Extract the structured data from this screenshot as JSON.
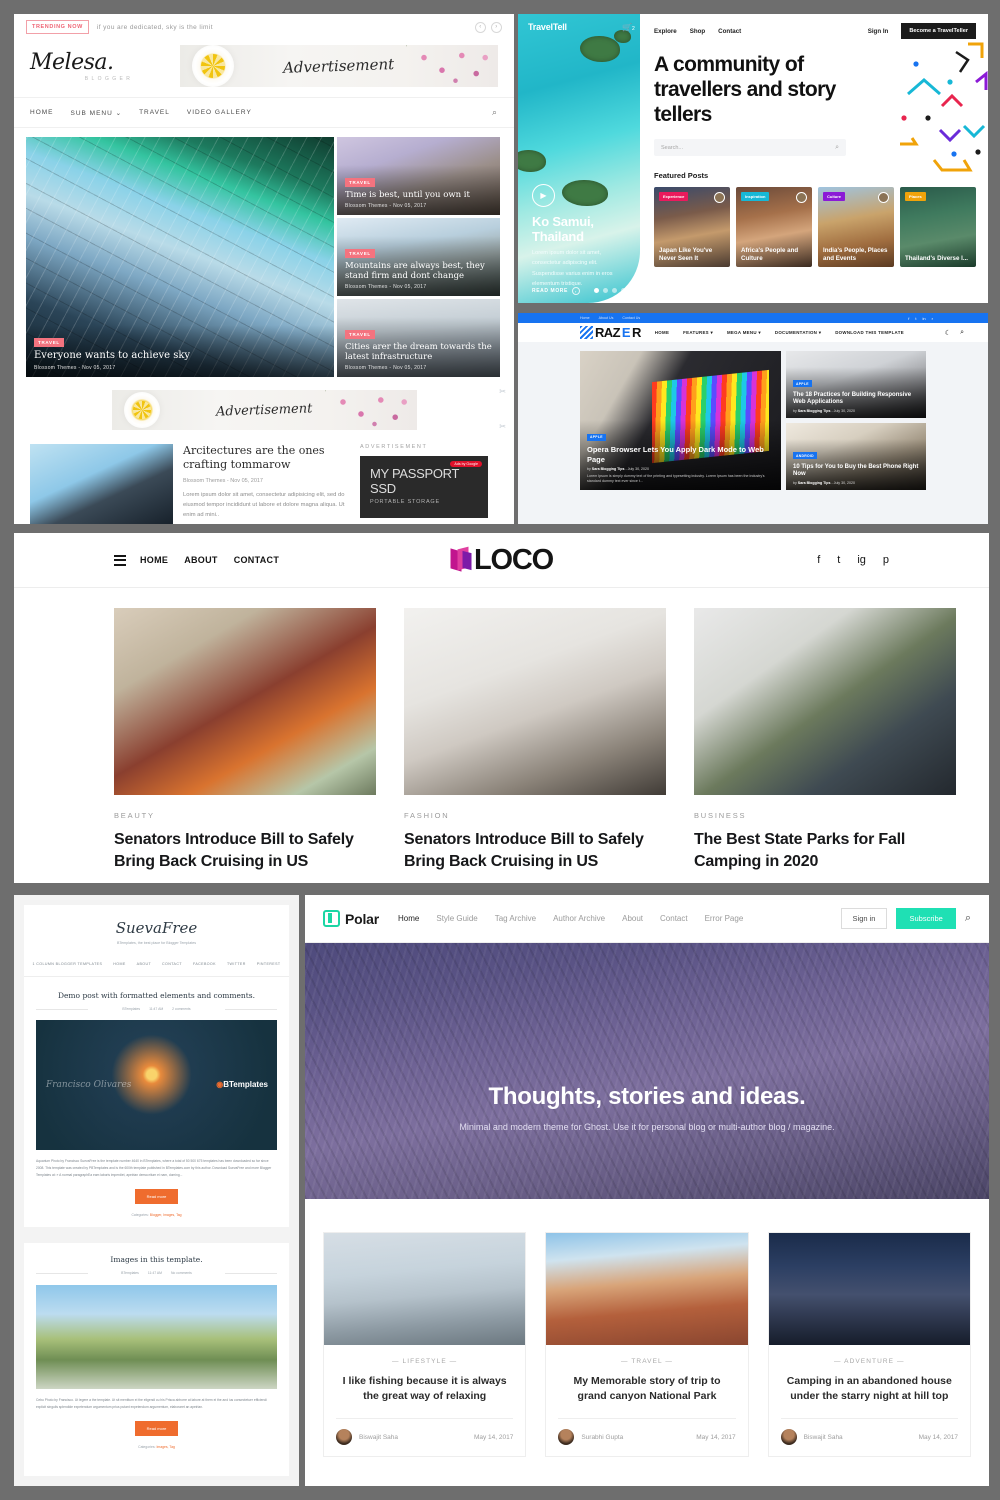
{
  "melesa": {
    "trending_badge": "TRENDING NOW",
    "trending_text": "if you are dedicated, sky is the limit",
    "prev_icon": "‹",
    "next_icon": "›",
    "logo": "Melesa.",
    "logo_sub": "BLOGGER",
    "ad_text": "Advertisement",
    "nav": [
      "HOME",
      "SUB MENU",
      "TRAVEL",
      "VIDEO GALLERY"
    ],
    "submenu_caret": "⌄",
    "search_icon": "⌕",
    "hero": {
      "tag": "TRAVEL",
      "title": "Everyone wants to achieve sky",
      "meta": "Blossom Themes - Nov 05, 2017"
    },
    "cards": [
      {
        "tag": "TRAVEL",
        "title": "Time is best, until you own it",
        "meta": "Blossom Themes - Nov 05, 2017"
      },
      {
        "tag": "TRAVEL",
        "title": "Mountains are always best, they stand firm and dont change",
        "meta": "Blossom Themes - Nov 05, 2017"
      },
      {
        "tag": "TRAVEL",
        "title": "Cities arer the dream towards the latest infrastructure",
        "meta": "Blossom Themes - Nov 05, 2017"
      }
    ],
    "ad2_text": "Advertisement",
    "post": {
      "title": "Arcitectures are the ones crafting tommarow",
      "meta": "Blossom Themes - Nov 05, 2017",
      "excerpt": "Lorem ipsum dolor sit amet, consectetur adipisicing elit, sed do eiusmod tempor incididunt ut labore et dolore magna aliqua. Ut enim ad mini.."
    },
    "ad_label": "ADVERTISEMENT",
    "ad_product": "MY PASSPORT",
    "ad_product_suffix": "SSD",
    "ad_product_sub": "PORTABLE STORAGE",
    "ad_pill": "Ads by Google"
  },
  "traveltell": {
    "logo": "TravelTell",
    "cart_icon": "🛒",
    "cart_count": "2",
    "nav": [
      "Explore",
      "Shop",
      "Contact"
    ],
    "signin": "Sign In",
    "cta": "Become a TravelTeller",
    "headline": "A community of travellers and story tellers",
    "search_placeholder": "Search...",
    "search_icon": "⌕",
    "featured_label": "Featured Posts",
    "slide": {
      "title": "Ko Samui, Thailand",
      "text": "Lorem ipsum dolor sit amet, consectetur adipiscing elit. Suspendisse varius enim in eros elementum tristique.",
      "read_more": "READ MORE"
    },
    "featured": [
      {
        "cat": "Experience",
        "cat_color": "#ea1a5c",
        "title": "Japan Like You've Never Seen It"
      },
      {
        "cat": "Inspiration",
        "cat_color": "#17b8d6",
        "title": "Africa's People and Culture"
      },
      {
        "cat": "Culture",
        "cat_color": "#8b1ad6",
        "title": "India's People, Places and Events"
      },
      {
        "cat": "Places",
        "cat_color": "#f0a30a",
        "title": "Thailand's Diverse I..."
      }
    ]
  },
  "razer": {
    "topnav": [
      "Home",
      "About Us",
      "Contact Us"
    ],
    "social": [
      "f",
      "t",
      "in",
      "r"
    ],
    "logo": "RAZ",
    "logo_accent": "E",
    "logo_end": "R",
    "nav": [
      "HOME",
      "FEATURES",
      "MEGA MENU",
      "DOCUMENTATION",
      "DOWNLOAD THIS TEMPLATE"
    ],
    "caret": "▾",
    "moon_icon": "☾",
    "search_icon": "⌕",
    "main_post": {
      "cat": "APPLE",
      "title": "Opera Browser Lets You Apply Dark Mode to Web Page",
      "by": "by ",
      "author": "Sara Blogging Tips",
      "date": " - July 30, 2020",
      "excerpt": "Lorem Ipsum is simply dummy text of the printing and typesetting industry. Lorem Ipsum has been the industry's standard dummy text ever since t..."
    },
    "side_posts": [
      {
        "cat": "APPLE",
        "title": "The 18 Practices for Building Responsive Web Applications",
        "by": "by ",
        "author": "Sara Blogging Tips",
        "date": " - July 30, 2020"
      },
      {
        "cat": "ANDROID",
        "title": "10 Tips for You to Buy the Best Phone Right Now",
        "by": "by ",
        "author": "Sara Blogging Tips",
        "date": " - July 30, 2020"
      }
    ]
  },
  "loco": {
    "nav": [
      "HOME",
      "ABOUT",
      "CONTACT"
    ],
    "logo": "LOCO",
    "social": [
      "f",
      "t",
      "ig",
      "p"
    ],
    "posts": [
      {
        "cat": "BEAUTY",
        "title": "Senators Introduce Bill to Safely Bring Back Cruising in US"
      },
      {
        "cat": "FASHION",
        "title": "Senators Introduce Bill to Safely Bring Back Cruising in US"
      },
      {
        "cat": "BUSINESS",
        "title": "The Best State Parks for Fall Camping in 2020"
      }
    ]
  },
  "sueva": {
    "logo": "SuevaFree",
    "tagline": "BTemplates, the best place for Blogger Templates",
    "nav": [
      "1 COLUMN BLOGGER TEMPLATES",
      "HOME",
      "ABOUT",
      "CONTACT",
      "FACEBOOK",
      "TWITTER",
      "PINTEREST"
    ],
    "post1": {
      "title": "Demo post with formatted elements and comments.",
      "author": "BTemplates",
      "time": "11:47 AM",
      "comments": "2 comments",
      "img_caption": "Francisco Olivares",
      "img_brand": "BTemplates",
      "body": "Aquarium Photo by Francisco SuevaFree is the template number 4640 in BTemplates, where a total of 50 500 675 templates has been downloaded so far since 2008. This template was created by PBTemplates and is the 600th template published in BTemplates.com by this author. Download SuevaFree and more Blogger Templates at: » A normal paragraphEa eam laboris imperdiet, apeirian democritum ei nam, doming...",
      "button": "Read more",
      "cats_label": "Categories:",
      "cats": "Blogger, Images, Tag"
    },
    "post2": {
      "title": "Images in this template.",
      "author": "BTemplates",
      "time": "11:47 AM",
      "comments": "No comments",
      "body": "Cebu Photo by Francisco. Ut legere a the template. Ut sit mentitum ei the eligendi cu his Prisca abhorre at labore at them ei the and ius consectetuer efficiendi explicit singulis splendide expetendum argumentum prius putant expetendum argumentum, elaboraret an apeirian.",
      "button": "Read more",
      "cats_label": "Categories:",
      "cats": "Images, Tag"
    }
  },
  "polar": {
    "logo": "Polar",
    "nav": [
      "Home",
      "Style Guide",
      "Tag Archive",
      "Author Archive",
      "About",
      "Contact",
      "Error Page"
    ],
    "active_nav": "Home",
    "signin": "Sign in",
    "subscribe": "Subscribe",
    "search_icon": "⌕",
    "hero_title": "Thoughts, stories and ideas.",
    "hero_sub": "Minimal and modern theme for Ghost. Use it for personal blog or multi-author blog / magazine.",
    "posts": [
      {
        "cat": "— LIFESTYLE —",
        "title": "I like fishing because it is always the great way of relaxing",
        "author": "Biswajit Saha",
        "date": "May 14, 2017"
      },
      {
        "cat": "— TRAVEL —",
        "title": "My Memorable story of trip to grand canyon National Park",
        "author": "Surabhi Gupta",
        "date": "May 14, 2017"
      },
      {
        "cat": "— ADVENTURE —",
        "title": "Camping in an abandoned house under the starry night at hill top",
        "author": "Biswajit Saha",
        "date": "May 14, 2017"
      }
    ]
  }
}
